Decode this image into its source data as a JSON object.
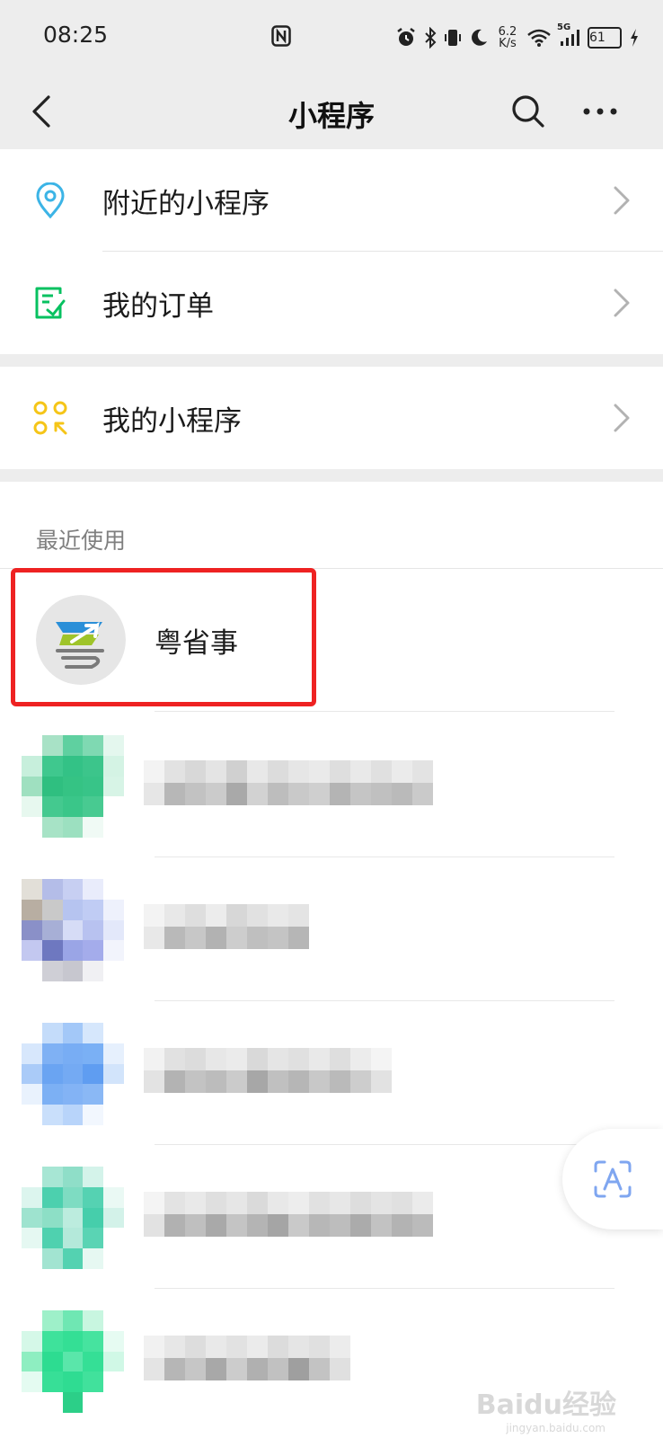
{
  "status_bar": {
    "time": "08:25",
    "net_speed_value": "6.2",
    "net_speed_unit": "K/s",
    "network": "5G",
    "battery": "61"
  },
  "nav": {
    "title": "小程序"
  },
  "menu": {
    "items": [
      {
        "label": "附近的小程序",
        "icon": "location-pin-icon"
      },
      {
        "label": "我的订单",
        "icon": "order-list-icon"
      },
      {
        "label": "我的小程序",
        "icon": "mini-program-grid-icon"
      }
    ]
  },
  "recent": {
    "section_label": "最近使用",
    "items": [
      {
        "name": "粤省事",
        "highlighted": true
      }
    ]
  },
  "watermark": {
    "main": "Baidu经验",
    "sub": "jingyan.baidu.com"
  },
  "colors": {
    "accent_red": "#ee2222",
    "nav_bg": "#ededed",
    "location_icon": "#3cb4e6",
    "order_icon": "#07c160",
    "grid_icon": "#f5c518"
  }
}
